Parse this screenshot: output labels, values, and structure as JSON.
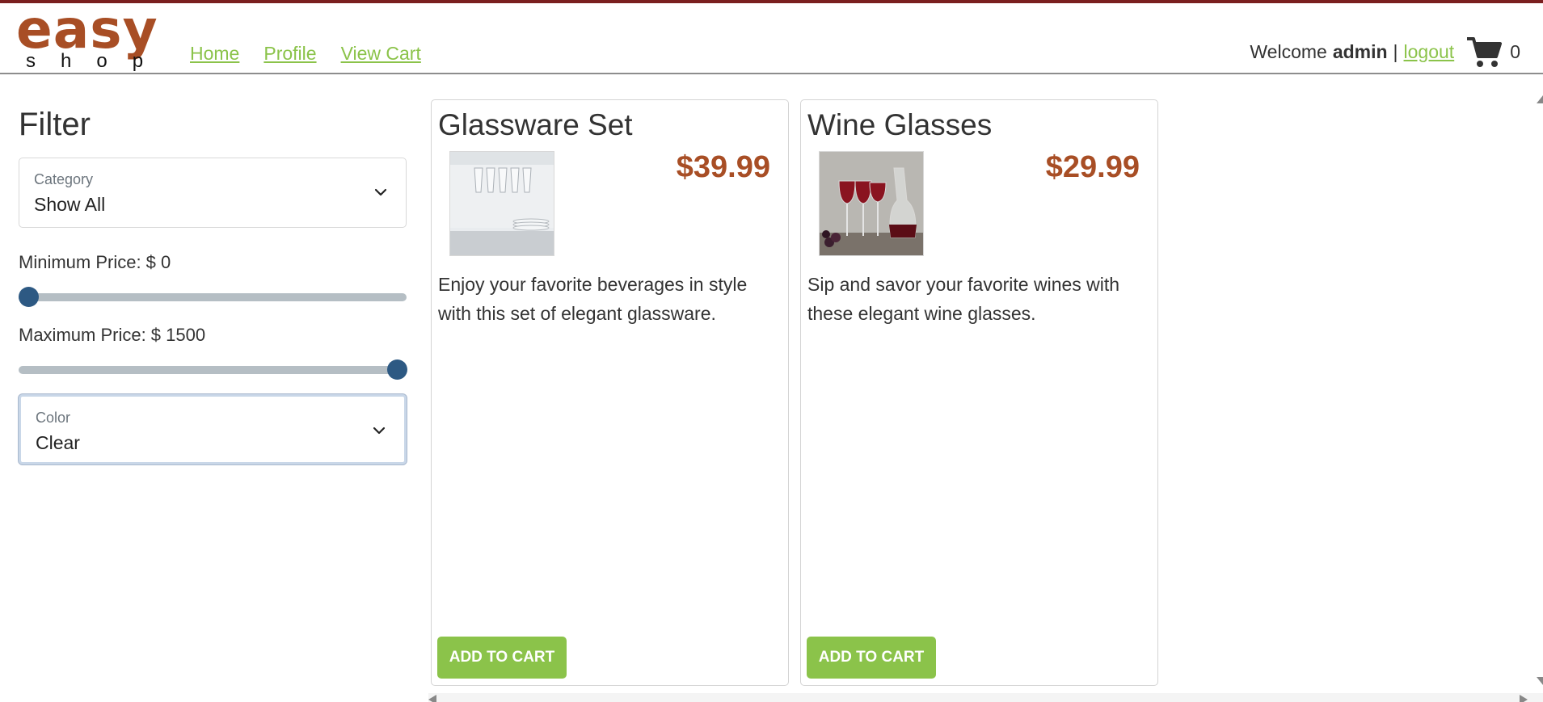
{
  "logo": {
    "word_top": "easy",
    "word_bottom": "shop"
  },
  "nav": {
    "home": "Home",
    "profile": "Profile",
    "view_cart": "View Cart"
  },
  "user": {
    "welcome": "Welcome",
    "username": "admin",
    "separator": "|",
    "logout": "logout",
    "cart_count": "0"
  },
  "filter": {
    "title": "Filter",
    "category": {
      "label": "Category",
      "value": "Show All"
    },
    "min_price": {
      "label": "Minimum Price: $ 0",
      "value": 0
    },
    "max_price": {
      "label": "Maximum Price: $ 1500",
      "value": 1500
    },
    "color": {
      "label": "Color",
      "value": "Clear"
    }
  },
  "products": [
    {
      "name": "Glassware Set",
      "price": "$39.99",
      "description": "Enjoy your favorite beverages in style with this set of elegant glassware.",
      "button": "ADD TO CART",
      "image_icon": "glassware-image"
    },
    {
      "name": "Wine Glasses",
      "price": "$29.99",
      "description": "Sip and savor your favorite wines with these elegant wine glasses.",
      "button": "ADD TO CART",
      "image_icon": "wine-glasses-image"
    }
  ],
  "colors": {
    "brand": "#a84e25",
    "accent": "#8bc34a",
    "slider_thumb": "#2d5983",
    "top_stripe": "#7a1f1f"
  }
}
